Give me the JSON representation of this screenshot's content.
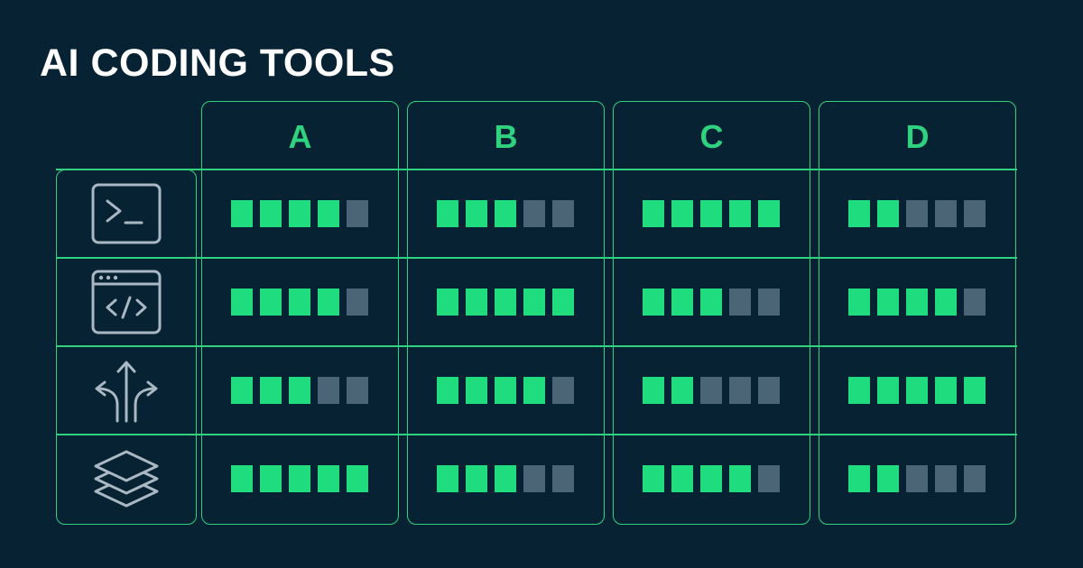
{
  "title": "AI CODING TOOLS",
  "colors": {
    "background": "#062233",
    "accent": "#2fd27e",
    "filled": "#1fdc7e",
    "empty": "#4b6476",
    "icon": "#a9b8c3"
  },
  "rows": [
    {
      "icon": "terminal-icon"
    },
    {
      "icon": "browser-code-icon"
    },
    {
      "icon": "branching-arrows-icon"
    },
    {
      "icon": "stacked-layers-icon"
    }
  ],
  "chart_data": {
    "type": "table",
    "title": "AI CODING TOOLS",
    "columns": [
      "A",
      "B",
      "C",
      "D"
    ],
    "rows": [
      "terminal-icon",
      "browser-code-icon",
      "branching-arrows-icon",
      "stacked-layers-icon"
    ],
    "scale_max": 5,
    "ratings": [
      [
        4,
        3,
        5,
        2
      ],
      [
        4,
        5,
        3,
        4
      ],
      [
        3,
        4,
        2,
        5
      ],
      [
        5,
        3,
        4,
        2
      ]
    ]
  }
}
